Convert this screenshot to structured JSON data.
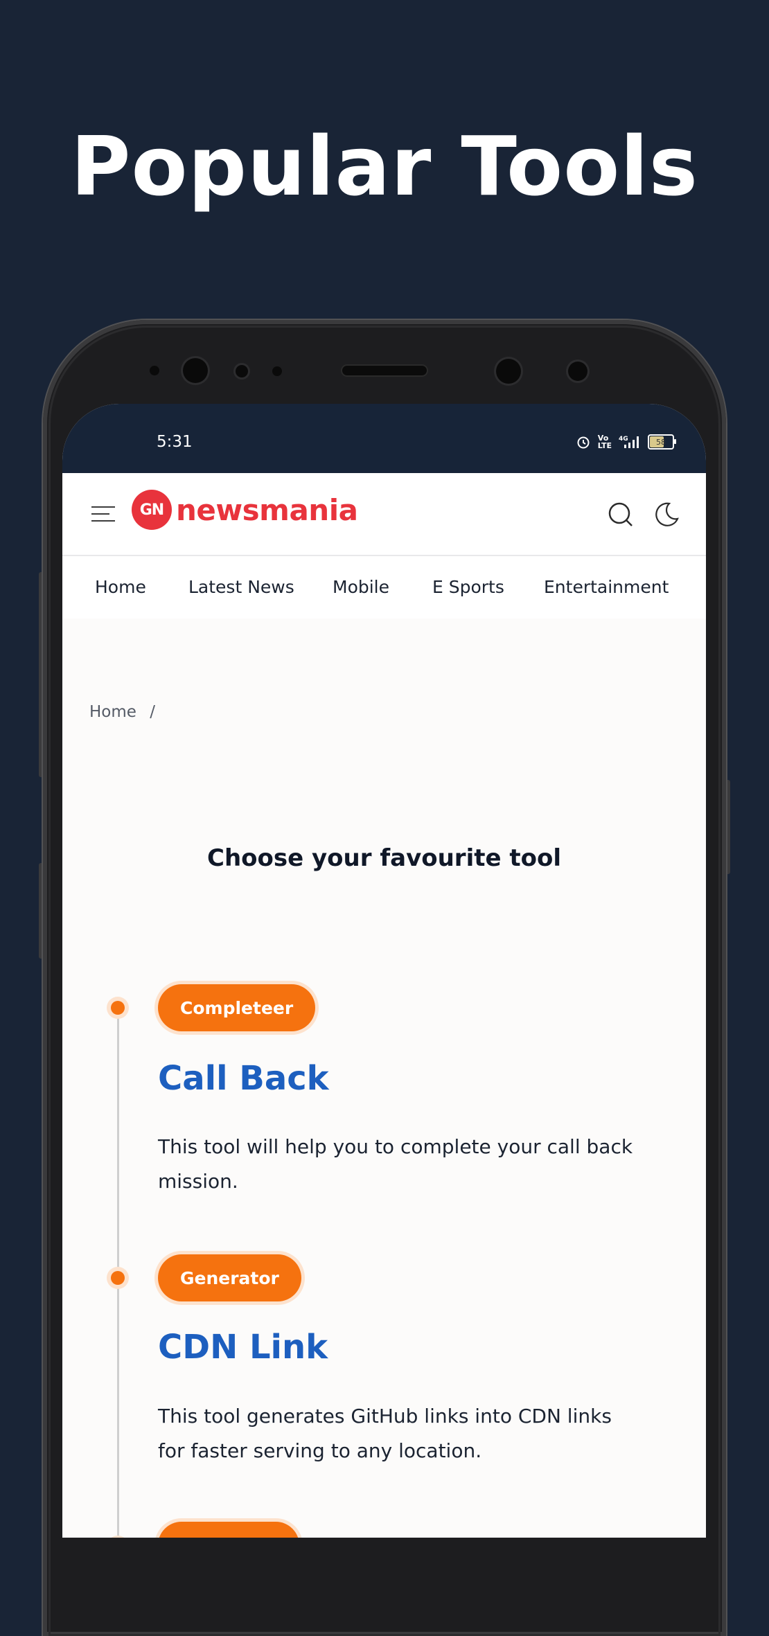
{
  "headline": "Popular Tools",
  "status_bar": {
    "time": "5:31",
    "battery": "58",
    "icons": [
      "alarm-icon",
      "volte-icon",
      "4g-signal-icon",
      "battery-icon"
    ]
  },
  "header": {
    "logo_mark": "GN",
    "logo_text": "newsmania",
    "brand_color": "#e8333c"
  },
  "nav": {
    "items": [
      "Home",
      "Latest News",
      "Mobile",
      "E Sports",
      "Entertainment"
    ]
  },
  "breadcrumb": {
    "home": "Home",
    "separator": "/"
  },
  "main": {
    "section_title": "Choose your favourite tool",
    "tools": [
      {
        "badge": "Completeer",
        "title": "Call Back",
        "description": "This tool will help you to complete your call back mission."
      },
      {
        "badge": "Generator",
        "title": "CDN Link",
        "description": "This tool generates GitHub links into CDN links for faster serving to any location."
      },
      {
        "badge": ""
      }
    ]
  },
  "colors": {
    "background": "#192436",
    "accent": "#f5720f",
    "link": "#1d5fbf"
  }
}
